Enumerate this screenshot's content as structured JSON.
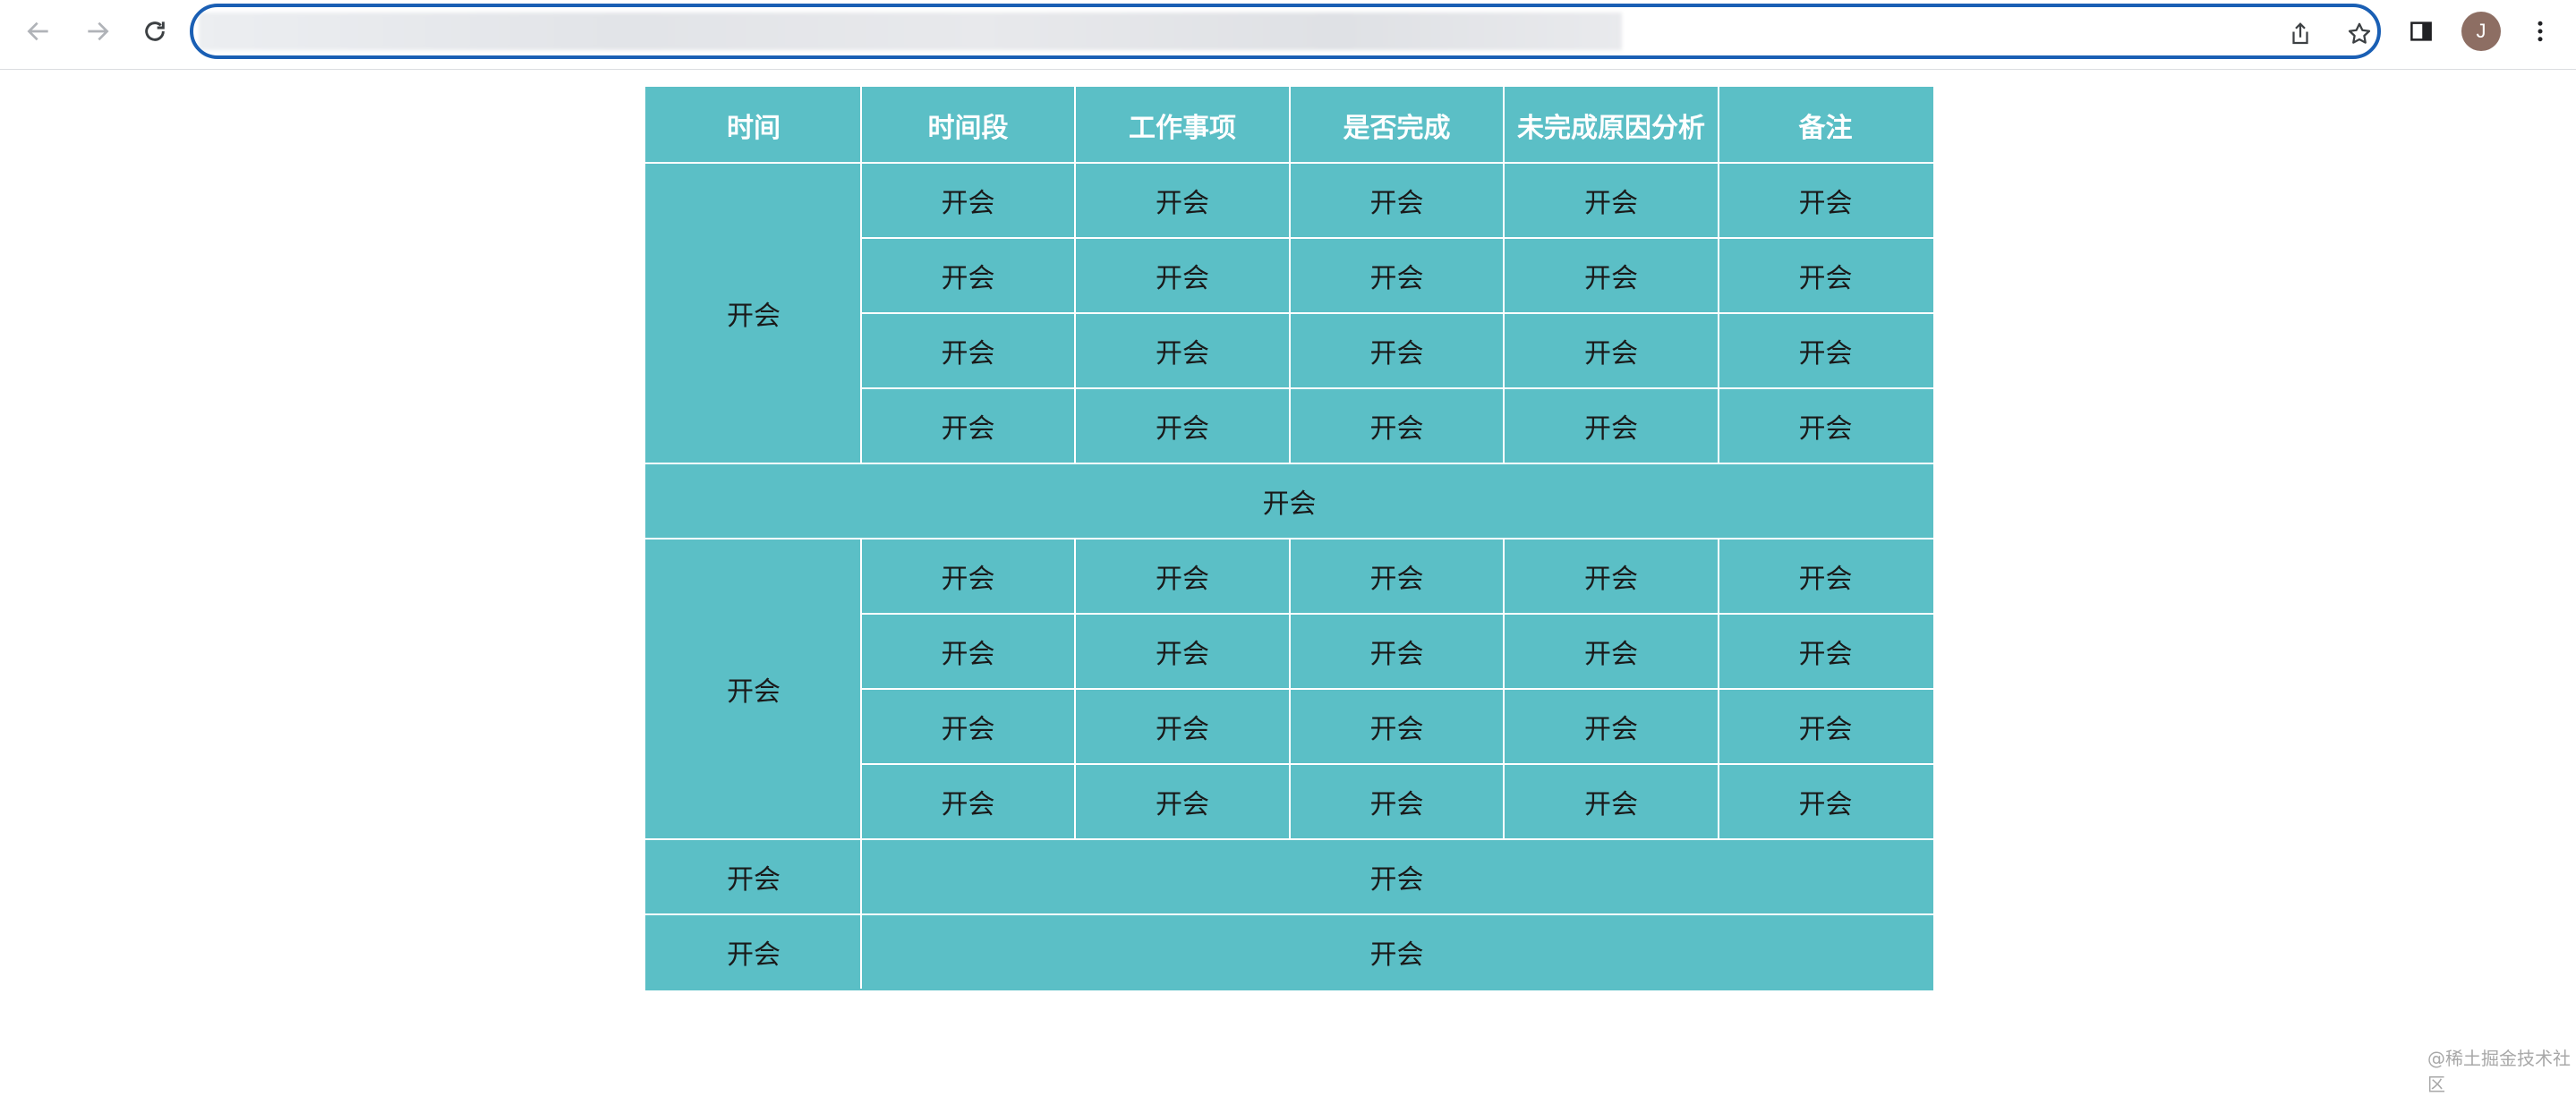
{
  "browser": {
    "icons": [
      "back-icon",
      "forward-icon",
      "reload-icon",
      "share-icon",
      "bookmark-star-icon",
      "side-panel-icon",
      "more-menu-icon"
    ],
    "avatar_initial": "J",
    "accent_color": "#1a5fb4"
  },
  "table": {
    "header_bg": "#5bbfc6",
    "headers": [
      "时间",
      "时间段",
      "工作事项",
      "是否完成",
      "未完成原因分析",
      "备注"
    ],
    "group1": {
      "date": "开会",
      "rows": [
        [
          "开会",
          "开会",
          "开会",
          "开会",
          "开会"
        ],
        [
          "开会",
          "开会",
          "开会",
          "开会",
          "开会"
        ],
        [
          "开会",
          "开会",
          "开会",
          "开会",
          "开会"
        ],
        [
          "开会",
          "开会",
          "开会",
          "开会",
          "开会"
        ]
      ]
    },
    "full_row": "开会",
    "group2": {
      "date": "开会",
      "rows": [
        [
          "开会",
          "开会",
          "开会",
          "开会",
          "开会"
        ],
        [
          "开会",
          "开会",
          "开会",
          "开会",
          "开会"
        ],
        [
          "开会",
          "开会",
          "开会",
          "开会",
          "开会"
        ],
        [
          "开会",
          "开会",
          "开会",
          "开会",
          "开会"
        ]
      ]
    },
    "summary_rows": [
      {
        "label": "开会",
        "value": "开会"
      },
      {
        "label": "开会",
        "value": "开会"
      }
    ]
  },
  "watermark": "@稀土掘金技术社区"
}
